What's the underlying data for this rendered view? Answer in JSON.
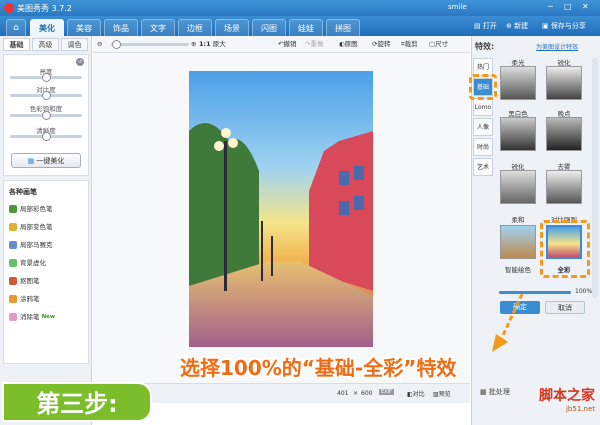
{
  "app": {
    "title": "美图秀秀 3.7.2",
    "user": "smile"
  },
  "nav_tabs": [
    {
      "label": "美化",
      "active": true
    },
    {
      "label": "美容"
    },
    {
      "label": "饰品"
    },
    {
      "label": "文字"
    },
    {
      "label": "边框"
    },
    {
      "label": "场景"
    },
    {
      "label": "闪图"
    },
    {
      "label": "娃娃"
    },
    {
      "label": "拼图"
    }
  ],
  "top_actions": {
    "open": "打开",
    "new": "新建",
    "save_share": "保存与分享"
  },
  "left_panel": {
    "tabs": [
      "基础",
      "高级",
      "调色"
    ],
    "sliders": [
      {
        "label": "亮度",
        "value": 0.5
      },
      {
        "label": "对比度",
        "value": 0.5
      },
      {
        "label": "色彩饱和度",
        "value": 0.5
      },
      {
        "label": "清晰度",
        "value": 0.5
      }
    ],
    "one_click_button": "一键美化",
    "brushes_title": "各种画笔",
    "brushes": [
      {
        "label": "局部彩色笔",
        "color": "#4a9a3a"
      },
      {
        "label": "局部变色笔",
        "color": "#e0b030"
      },
      {
        "label": "局部马赛克",
        "color": "#6a8acd"
      },
      {
        "label": "背景虚化",
        "color": "#6ac06a"
      },
      {
        "label": "抠图笔",
        "color": "#d25a3a"
      },
      {
        "label": "涂鸦笔",
        "color": "#e89a30"
      },
      {
        "label": "消除笔",
        "color": "#e79ac0",
        "badge": "New"
      }
    ]
  },
  "toolbar": {
    "ratio": "1:1",
    "original_size": "原大",
    "undo": "撤销",
    "redo": "重做",
    "original": "原图",
    "rotate": "旋转",
    "crop": "裁剪",
    "size": "尺寸"
  },
  "status_bar": {
    "width": "401",
    "times": "×",
    "height": "600",
    "exif": "EXIF",
    "compare": "对比",
    "preview": "预览",
    "batch": "批处理"
  },
  "right_panel": {
    "title": "特效:",
    "design_link": "为美图设计特效",
    "vertical_tabs": [
      "热门",
      "基础",
      "Lomo",
      "人像",
      "时尚",
      "艺术"
    ],
    "active_tab": "基础",
    "effects": [
      {
        "label": "柔光"
      },
      {
        "label": "锐化"
      },
      {
        "label": "黑白色"
      },
      {
        "label": "晚点"
      },
      {
        "label": "锐化"
      },
      {
        "label": "去雾"
      },
      {
        "label": "柔和"
      },
      {
        "label": "对比强烈"
      },
      {
        "label": "智能绘色"
      },
      {
        "label": "全彩",
        "selected": true
      }
    ],
    "opacity_label": "100%",
    "opacity_value": 1.0,
    "confirm": "确定",
    "cancel": "取消"
  },
  "overlay": {
    "banner": "选择100%的“基础-全彩”特效",
    "step": "第三步:",
    "watermark": "脚本之家",
    "watermark_url": "jb51.net"
  },
  "colors": {
    "accent": "#f39a1c",
    "brand": "#2a78c2",
    "step_green": "#7bbd2a"
  }
}
